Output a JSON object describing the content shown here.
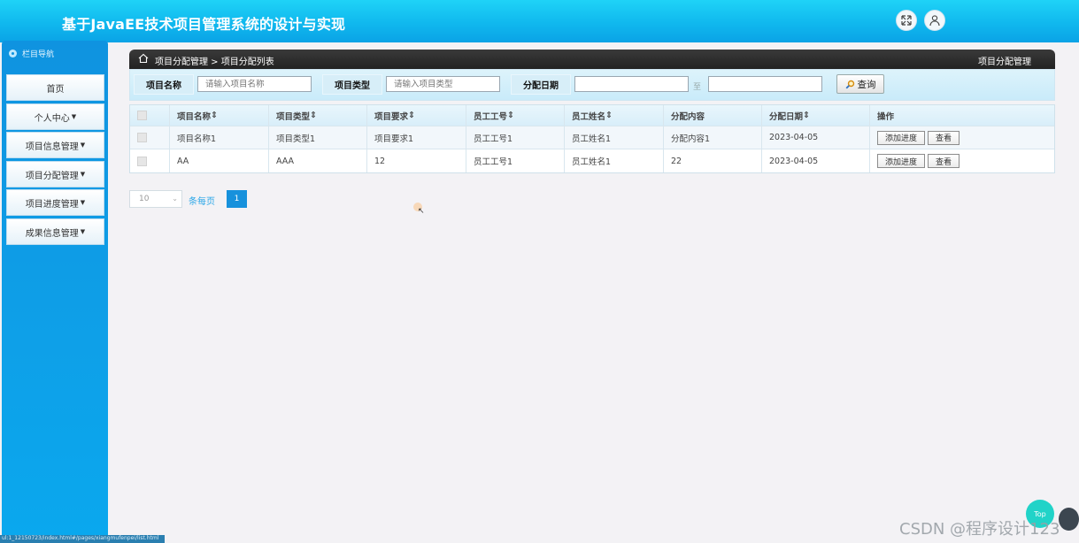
{
  "header": {
    "title": "基于JavaEE技术项目管理系统的设计与实现",
    "fullscreen_icon": "expand-arrows-icon",
    "user_icon": "user-avatar-icon"
  },
  "sidebar": {
    "heading": "栏目导航",
    "items": [
      {
        "label": "首页",
        "dropdown": false
      },
      {
        "label": "个人中心",
        "dropdown": true
      },
      {
        "label": "项目信息管理",
        "dropdown": true
      },
      {
        "label": "项目分配管理",
        "dropdown": true
      },
      {
        "label": "项目进度管理",
        "dropdown": true
      },
      {
        "label": "成果信息管理",
        "dropdown": true
      }
    ]
  },
  "breadcrumb": {
    "path": "项目分配管理 > 项目分配列表",
    "right_title": "项目分配管理"
  },
  "filters": {
    "name_label": "项目名称",
    "name_placeholder": "请输入项目名称",
    "type_label": "项目类型",
    "type_placeholder": "请输入项目类型",
    "date_label": "分配日期",
    "date_to": "至",
    "query_label": "查询"
  },
  "table": {
    "columns": [
      "项目名称",
      "项目类型",
      "项目要求",
      "员工工号",
      "员工姓名",
      "分配内容",
      "分配日期",
      "操作"
    ],
    "rows": [
      {
        "name": "项目名称1",
        "type": "项目类型1",
        "req": "项目要求1",
        "emp_no": "员工工号1",
        "emp_name": "员工姓名1",
        "content": "分配内容1",
        "date": "2023-04-05"
      },
      {
        "name": "AA",
        "type": "AAA",
        "req": "12",
        "emp_no": "员工工号1",
        "emp_name": "员工姓名1",
        "content": "22",
        "date": "2023-04-05"
      }
    ],
    "action_add": "添加进度",
    "action_view": "查看"
  },
  "pagination": {
    "page_size": "10",
    "per_page_label": "条每页",
    "current_page": "1"
  },
  "floating": {
    "top_label": "Top"
  },
  "watermark": "CSDN @程序设计123",
  "status_url": "ul:1_12150723/index.html#/pages/xiangmufenpei/list.html"
}
